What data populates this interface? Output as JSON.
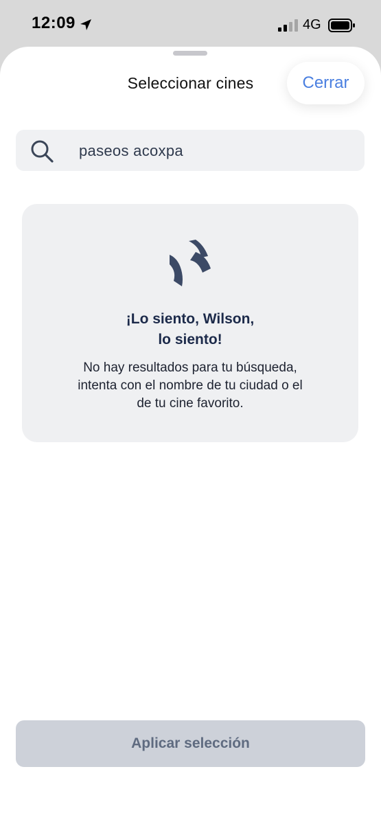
{
  "status_bar": {
    "time": "12:09",
    "network": "4G",
    "icons": {
      "location": "location-arrow-icon",
      "signal": "cellular-signal-icon",
      "battery": "battery-icon"
    }
  },
  "sheet": {
    "title": "Seleccionar cines",
    "close_label": "Cerrar",
    "accent_color": "#4a7fe0"
  },
  "search": {
    "value": "paseos acoxpa",
    "icon": "search-icon"
  },
  "empty_state": {
    "icon": "brand-logo-icon",
    "title_line1": "¡Lo siento, Wilson,",
    "title_line2": "lo siento!",
    "message_line1": "No hay resultados para tu búsqueda,",
    "message_line2": "intenta con el nombre de tu ciudad o el",
    "message_line3": "de tu cine favorito."
  },
  "footer": {
    "apply_label": "Aplicar selección",
    "apply_state": "disabled"
  }
}
